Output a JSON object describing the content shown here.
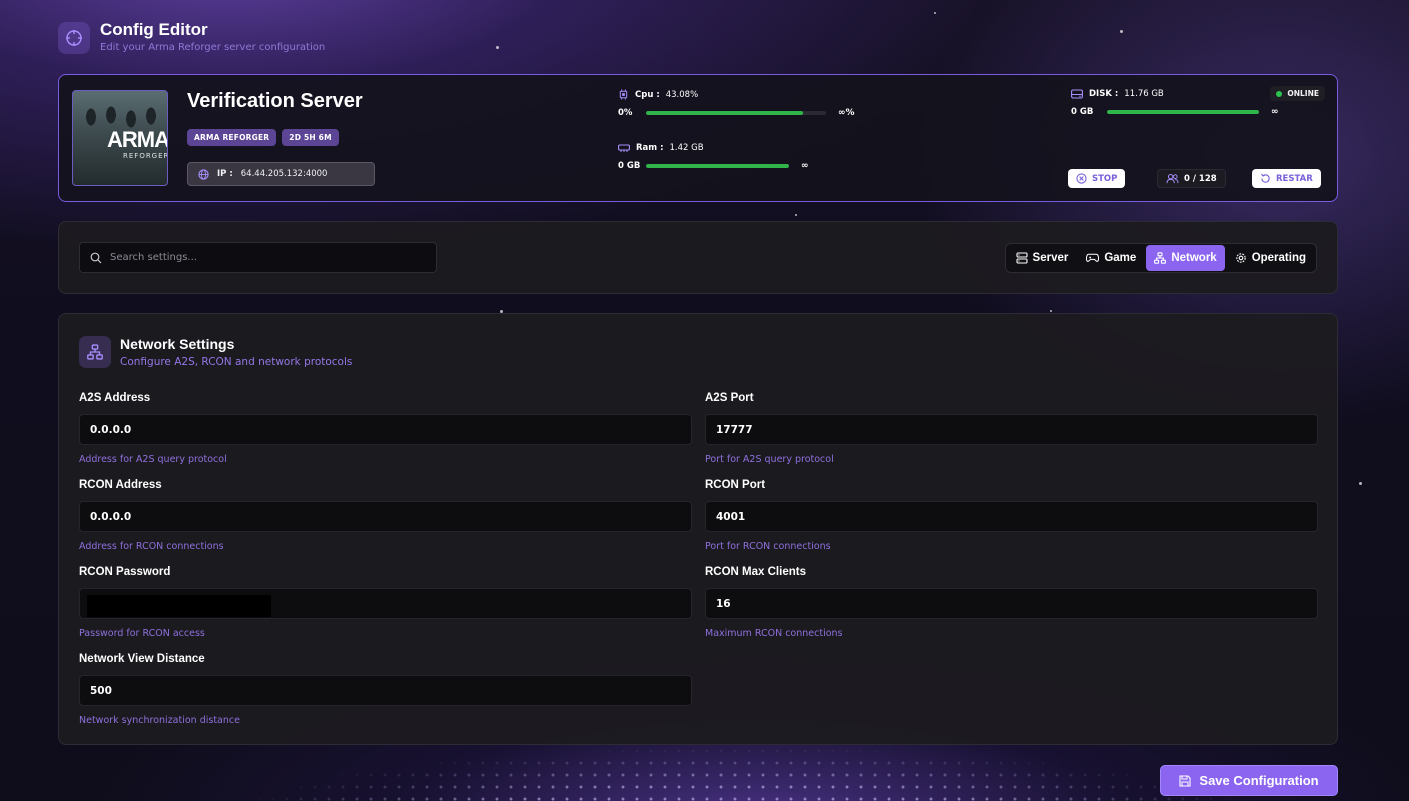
{
  "header": {
    "title": "Config Editor",
    "subtitle": "Edit your Arma Reforger server configuration"
  },
  "server": {
    "thumbnail_logo": "ARMA",
    "thumbnail_sub": "REFORGER",
    "name": "Verification Server",
    "badges": [
      "ARMA REFORGER",
      "2D 5H 6M"
    ],
    "ip_label": "IP :",
    "ip": "64.44.205.132:4000",
    "cpu": {
      "label": "Cpu :",
      "value": "43.08%",
      "min": "0%",
      "max": "∞%",
      "fill": 0.87
    },
    "ram": {
      "label": "Ram :",
      "value": "1.42 GB",
      "min": "0 GB",
      "max": "∞",
      "fill": 1.0
    },
    "disk": {
      "label": "DISK :",
      "value": "11.76 GB",
      "min": "0 GB",
      "max": "∞",
      "fill": 1.0
    },
    "status": "ONLINE",
    "status_color": "#2bc44f",
    "stop_label": "STOP",
    "players": "0 / 128",
    "restart_label": "RESTAR"
  },
  "toolbar": {
    "search_placeholder": "Search settings...",
    "tabs": [
      {
        "label": "Server",
        "icon": "server-icon",
        "active": false
      },
      {
        "label": "Game",
        "icon": "gamepad-icon",
        "active": false
      },
      {
        "label": "Network",
        "icon": "network-icon",
        "active": true
      },
      {
        "label": "Operating",
        "icon": "gear-icon",
        "active": false
      }
    ]
  },
  "panel": {
    "title": "Network Settings",
    "subtitle": "Configure A2S, RCON and network protocols",
    "fields": {
      "a2s_address": {
        "label": "A2S Address",
        "value": "0.0.0.0",
        "hint": "Address for A2S query protocol"
      },
      "a2s_port": {
        "label": "A2S Port",
        "value": "17777",
        "hint": "Port for A2S query protocol"
      },
      "rcon_address": {
        "label": "RCON Address",
        "value": "0.0.0.0",
        "hint": "Address for RCON connections"
      },
      "rcon_port": {
        "label": "RCON Port",
        "value": "4001",
        "hint": "Port for RCON connections"
      },
      "rcon_password": {
        "label": "RCON Password",
        "value": "",
        "hint": "Password for RCON access"
      },
      "rcon_max_clients": {
        "label": "RCON Max Clients",
        "value": "16",
        "hint": "Maximum RCON connections"
      },
      "network_view_distance": {
        "label": "Network View Distance",
        "value": "500",
        "hint": "Network synchronization distance"
      }
    }
  },
  "save_label": "Save Configuration",
  "colors": {
    "accent": "#8b65f0",
    "progress": "#2fb54a",
    "hint": "#8f70dd"
  }
}
